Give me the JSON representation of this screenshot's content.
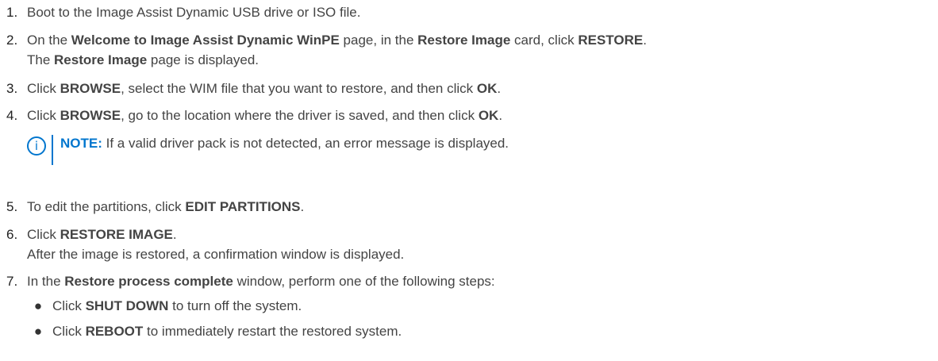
{
  "steps": [
    {
      "number": "1.",
      "t1": "Boot to the Image Assist Dynamic USB drive or ISO file."
    },
    {
      "number": "2.",
      "t1": "On the ",
      "b1": "Welcome to Image Assist Dynamic WinPE",
      "t2": " page, in the ",
      "b2": "Restore Image",
      "t3": " card, click ",
      "b3": "RESTORE",
      "t4": ".",
      "result_pre": "The ",
      "result_bold": "Restore Image",
      "result_post": " page is displayed."
    },
    {
      "number": "3.",
      "t1": "Click ",
      "b1": "BROWSE",
      "t2": ", select the WIM file that you want to restore, and then click ",
      "b2": "OK",
      "t3": "."
    },
    {
      "number": "4.",
      "t1": "Click ",
      "b1": "BROWSE",
      "t2": ", go to the location where the driver is saved, and then click ",
      "b2": "OK",
      "t3": "."
    },
    {
      "number": "5.",
      "t1": "To edit the partitions, click ",
      "b1": "EDIT PARTITIONS",
      "t2": "."
    },
    {
      "number": "6.",
      "t1": "Click ",
      "b1": "RESTORE IMAGE",
      "t2": ".",
      "result": "After the image is restored, a confirmation window is displayed."
    },
    {
      "number": "7.",
      "t1": "In the ",
      "b1": "Restore process complete",
      "t2": " window, perform one of the following steps:"
    }
  ],
  "note": {
    "icon": "info-icon",
    "icon_glyph": "i",
    "label": "NOTE:",
    "text": " If a valid driver pack is not detected, an error message is displayed."
  },
  "bullets": [
    {
      "glyph": "●",
      "t1": "Click ",
      "b1": "SHUT DOWN",
      "t2": " to turn off the system."
    },
    {
      "glyph": "●",
      "t1": "Click ",
      "b1": "REBOOT",
      "t2": " to immediately restart the restored system."
    }
  ],
  "colors": {
    "text": "#444444",
    "accent": "#0076ce"
  }
}
